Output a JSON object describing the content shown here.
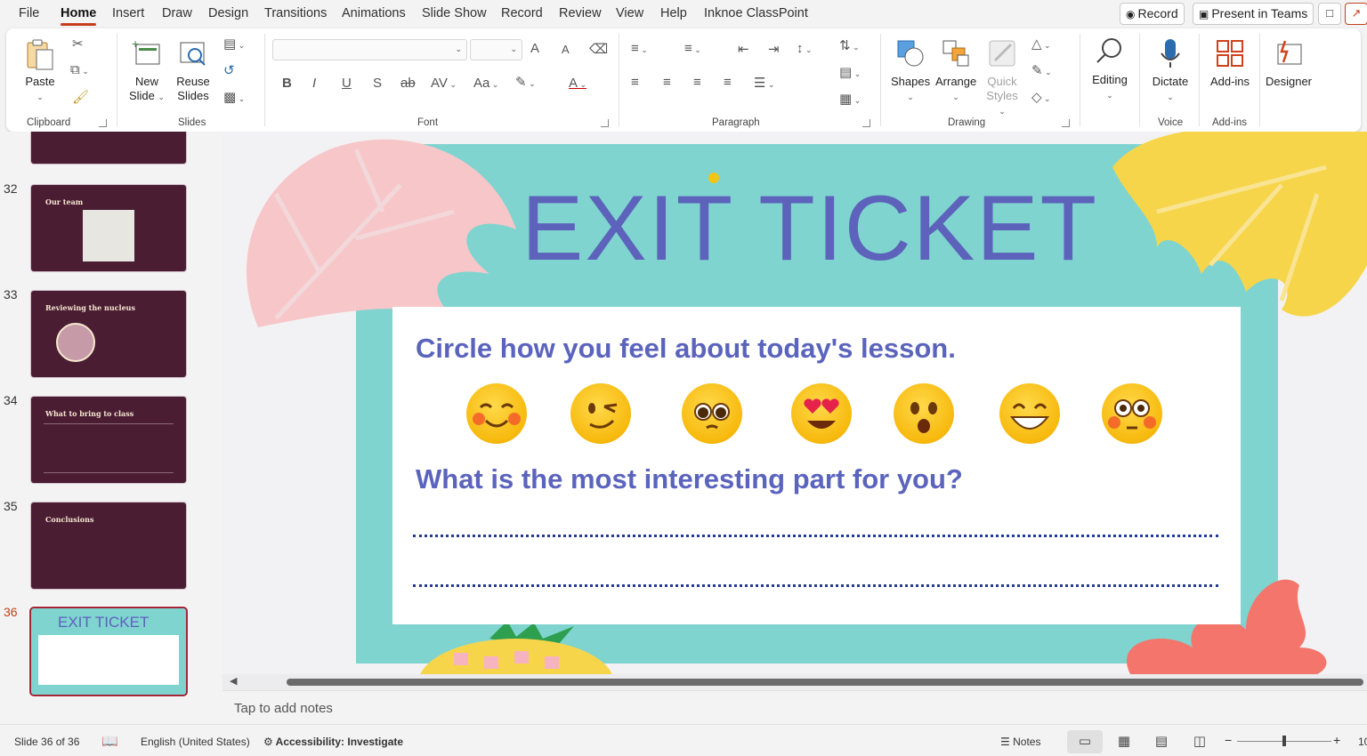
{
  "menu": {
    "tabs": [
      "File",
      "Home",
      "Insert",
      "Draw",
      "Design",
      "Transitions",
      "Animations",
      "Slide Show",
      "Record",
      "Review",
      "View",
      "Help",
      "Inknoe ClassPoint"
    ],
    "active_tab": "Home",
    "record_label": "Record",
    "present_label": "Present in Teams"
  },
  "ribbon": {
    "clipboard": {
      "paste": "Paste",
      "group": "Clipboard"
    },
    "slides": {
      "new_slide_1": "New",
      "new_slide_2": "Slide",
      "reuse_1": "Reuse",
      "reuse_2": "Slides",
      "group": "Slides"
    },
    "font": {
      "group": "Font",
      "bold": "B",
      "italic": "I",
      "underline": "U",
      "shadow": "S",
      "strike": "ab",
      "spacing": "AV",
      "case": "Aa",
      "grow": "A",
      "shrink": "A",
      "color": "A"
    },
    "paragraph": {
      "group": "Paragraph"
    },
    "drawing": {
      "shapes": "Shapes",
      "arrange": "Arrange",
      "quick_1": "Quick",
      "quick_2": "Styles",
      "group": "Drawing"
    },
    "editing": {
      "label": "Editing"
    },
    "voice": {
      "dictate": "Dictate",
      "group": "Voice"
    },
    "addins": {
      "label": "Add-ins",
      "group": "Add-ins"
    },
    "designer": {
      "label": "Designer"
    }
  },
  "thumbnails": [
    {
      "num": "32",
      "title": "Our team"
    },
    {
      "num": "33",
      "title": "Reviewing the nucleus"
    },
    {
      "num": "34",
      "title": "What to bring to class"
    },
    {
      "num": "35",
      "title": "Conclusions"
    },
    {
      "num": "36",
      "title": "EXIT TICKET"
    }
  ],
  "slide": {
    "title": "EXIT TICKET",
    "question_1": "Circle how you feel about today's lesson.",
    "question_2": "What is the most interesting part for you?",
    "emojis": [
      "blushing-smile",
      "winking",
      "pleading",
      "heart-eyes",
      "surprised",
      "grinning",
      "flushed"
    ],
    "colors": {
      "title": "#5d62bb",
      "question": "#5b64bd",
      "teal": "#7fd4d0",
      "leaf_pink": "#f7c6c9",
      "leaf_yellow": "#f7d54a",
      "leaf_coral": "#f4756b"
    }
  },
  "notes_placeholder": "Tap to add notes",
  "status": {
    "slide_info": "Slide 36 of 36",
    "language": "English (United States)",
    "accessibility": "Accessibility: Investigate",
    "notes": "Notes",
    "zoom": "10"
  }
}
